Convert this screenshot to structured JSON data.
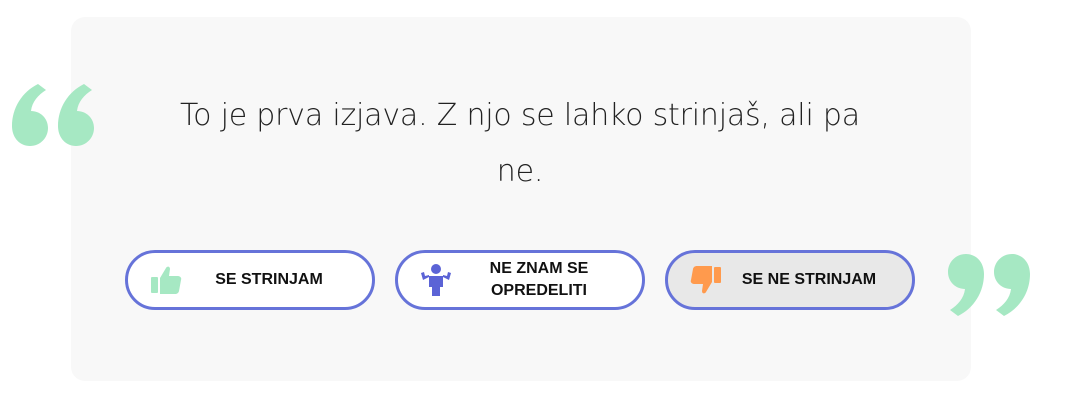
{
  "statement": {
    "text": "To je prva izjava. Z njo se lahko strinjaš, ali pa ne."
  },
  "buttons": [
    {
      "id": "agree",
      "label": "SE STRINJAM",
      "icon": "thumbs-up-icon",
      "icon_color": "#a6e8c3",
      "selected": false
    },
    {
      "id": "unsure",
      "label": "NE ZNAM SE\nOPREDELITI",
      "icon": "person-shrug-icon",
      "icon_color": "#5b63d6",
      "selected": false
    },
    {
      "id": "disagree",
      "label": "SE NE STRINJAM",
      "icon": "thumbs-down-icon",
      "icon_color": "#ff9a4d",
      "selected": true
    }
  ],
  "colors": {
    "accent_border": "#6673d9",
    "quote_marks": "#a6e8c3",
    "card_background": "#f8f8f8",
    "selected_button_background": "#e8e8e8"
  },
  "decorations": {
    "open_quote_icon": "open-quote-icon",
    "close_quote_icon": "close-quote-icon"
  }
}
